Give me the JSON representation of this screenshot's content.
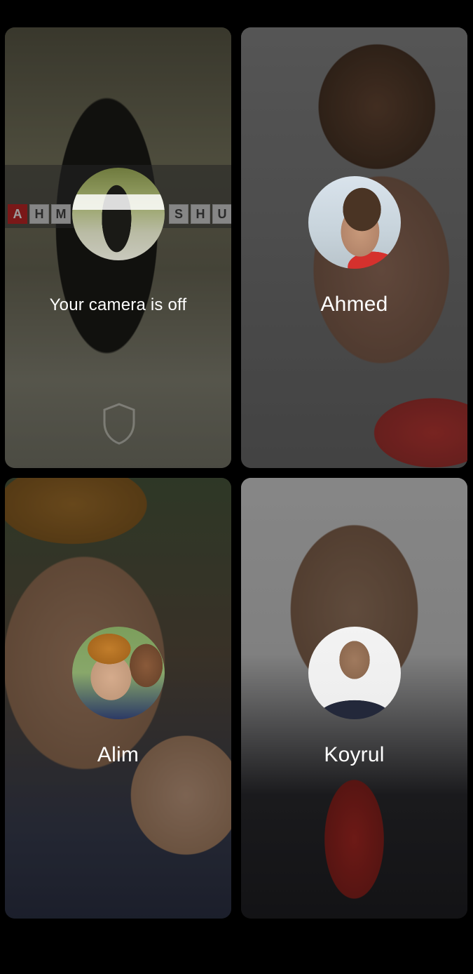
{
  "participants": [
    {
      "name": "Your camera is off",
      "avatar_icon": "user-photo-self",
      "is_self": true
    },
    {
      "name": "Ahmed",
      "avatar_icon": "user-photo-ahmed",
      "is_self": false
    },
    {
      "name": "Alim",
      "avatar_icon": "user-photo-alim",
      "is_self": false
    },
    {
      "name": "Koyrul",
      "avatar_icon": "user-photo-koyrul",
      "is_self": false
    }
  ],
  "self_banner": {
    "letters_left": [
      "A",
      "H",
      "M"
    ],
    "letters_right": [
      "S",
      "H",
      "U"
    ]
  },
  "colors": {
    "background": "#000000",
    "text": "#ffffff",
    "banner_accent": "#c62828"
  }
}
